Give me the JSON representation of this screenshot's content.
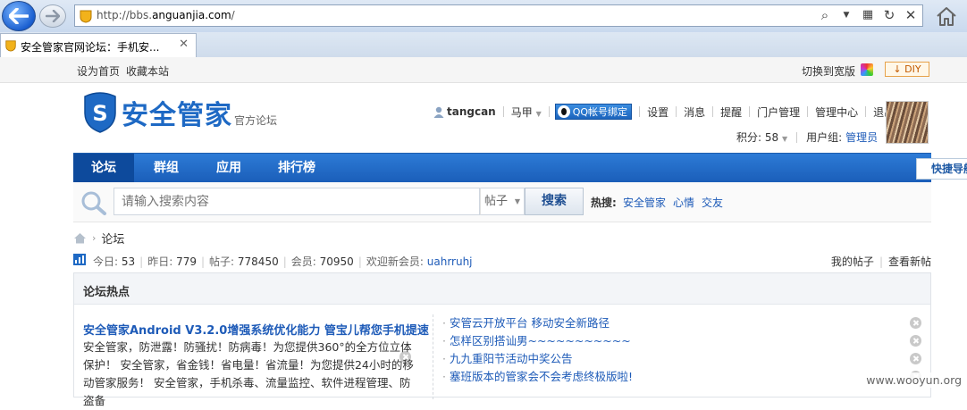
{
  "browser": {
    "url_prefix": "http://bbs.",
    "url_domain": "anguanjia.com",
    "url_suffix": "/",
    "tab_title": "安全管家官网论坛：手机安...",
    "tab_close": "✕"
  },
  "topbar": {
    "set_home": "设为首页",
    "bookmark": "收藏本站",
    "switch_width": "切换到宽版",
    "diy": "DIY"
  },
  "logo": {
    "text": "安全管家",
    "sub": "官方论坛"
  },
  "user": {
    "username": "tangcan",
    "horse": "马甲",
    "qq_bind": "QQ帐号绑定",
    "links": [
      "设置",
      "消息",
      "提醒",
      "门户管理",
      "管理中心",
      "退出"
    ],
    "score_label": "积分: 58",
    "group_label": "用户组:",
    "group_value": "管理员"
  },
  "nav": {
    "items": [
      "论坛",
      "群组",
      "应用",
      "排行榜"
    ],
    "quick": "快捷导航"
  },
  "search": {
    "placeholder": "请输入搜索内容",
    "type": "帖子",
    "button": "搜索",
    "hot_label": "热搜:",
    "hot_links": [
      "安全管家",
      "心情",
      "交友"
    ]
  },
  "breadcrumb": {
    "current": "论坛"
  },
  "stats": {
    "today_label": "今日:",
    "today": "53",
    "yesterday_label": "昨日:",
    "yesterday": "779",
    "posts_label": "帖子:",
    "posts": "778450",
    "members_label": "会员:",
    "members": "70950",
    "welcome_label": "欢迎新会员:",
    "new_member": "uahrruhj",
    "my_posts": "我的帖子",
    "new_posts": "查看新帖"
  },
  "hot": {
    "title": "论坛热点",
    "feature_title": "安全管家Android V3.2.0增强系统优化能力 管宝儿帮您手机提速",
    "feature_body": "安全管家，防泄露！防骚扰！防病毒！为您提供360°的全方位立体保护！ 安全管家，省金钱！省电量！省流量！为您提供24小时的移动管家服务！ 安全管家，手机杀毒、流量监控、软件进程管理、防盗备",
    "items": [
      "安管云开放平台 移动安全新路径",
      "怎样区别搭讪男~~~~~~~~~~~",
      "九九重阳节活动中奖公告",
      "塞班版本的管家会不会考虑终极版啦!"
    ]
  },
  "watermark": "www.wooyun.org"
}
